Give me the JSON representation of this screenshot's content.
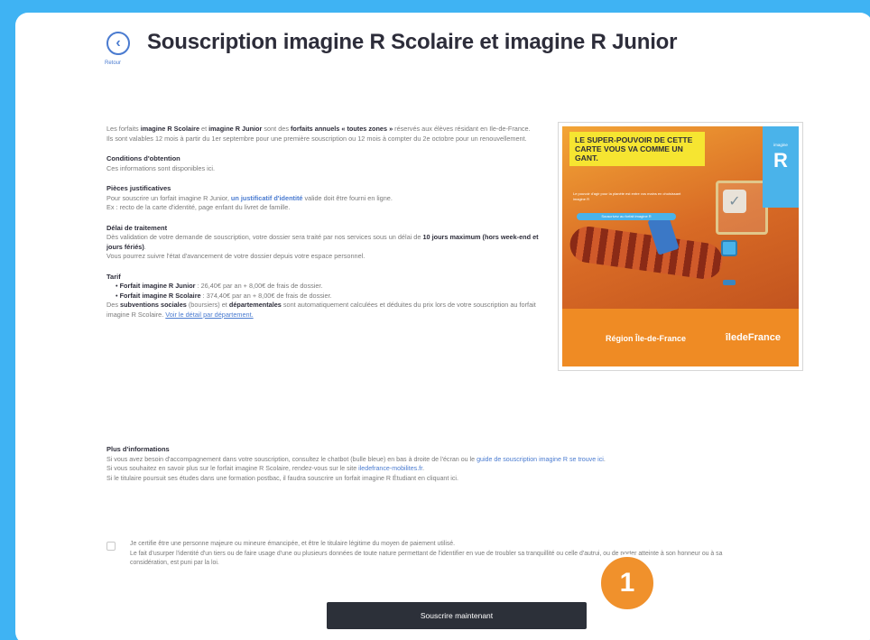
{
  "header": {
    "back_icon": "chevron-left-icon",
    "back_label": "Retour",
    "title": "Souscription imagine R Scolaire et imagine R Junior"
  },
  "intro": {
    "t1": "Les forfaits ",
    "b1": "imagine R Scolaire",
    "t2": " et ",
    "b2": "imagine R Junior",
    "t3": " sont des ",
    "b3": "forfaits annuels « toutes zones »",
    "t4": " réservés aux élèves résidant en Ile-de-France.",
    "line2": "Ils sont valables 12 mois à partir du 1er septembre pour une première souscription ou 12 mois à compter du 2e octobre pour un renouvellement."
  },
  "conditions": {
    "title": "Conditions d'obtention",
    "text": "Ces informations sont disponibles ici."
  },
  "pieces": {
    "title": "Pièces justificatives",
    "t1": "Pour souscrire un forfait imagine R Junior, ",
    "link": "un justificatif d'identité",
    "t2": " valide doit être fourni en ligne.",
    "line2": "Ex : recto de la carte d'identité, page enfant du livret de famille."
  },
  "delai": {
    "title": "Délai de traitement",
    "t1": "Dès validation de votre demande de souscription, votre dossier sera traité par nos services sous un délai de ",
    "b1": "10 jours maximum (hors week-end et jours fériés)",
    "t2": ".",
    "line2": "Vous pourrez suivre l'état d'avancement de votre dossier depuis votre espace personnel."
  },
  "tarif": {
    "title": "Tarif",
    "items": [
      {
        "label": "Forfait imagine R Junior",
        "text": " : 26,40€ par an + 8,00€ de frais de dossier."
      },
      {
        "label": "Forfait imagine R Scolaire",
        "text": " : 374,40€ par an + 8,00€ de frais de dossier."
      }
    ],
    "t1": "Des ",
    "b1": "subventions sociales",
    "t2": " (boursiers) et ",
    "b2": "départementales",
    "t3": " sont automatiquement calculées et déduites du prix lors de votre souscription au forfait imagine R Scolaire. ",
    "link": "Voir le détail par département."
  },
  "promo": {
    "headline": "LE SUPER-POUVOIR DE CETTE CARTE VOUS VA COMME UN GANT.",
    "sub": "Le pouvoir d'agir pour la planète est entre vos mains en choisissant imagine R",
    "cta": "Souscrivez au forfait imagine R",
    "logo_small": "imagine",
    "logo_big": "R",
    "brand1": "Région Île-de-France",
    "brand2": "îledeFrance"
  },
  "more": {
    "title": "Plus d'informations",
    "t1": "Si vous avez besoin d'accompagnement dans votre souscription, consultez le chatbot (bulle bleue) en bas à droite de l'écran ou le ",
    "link1": "guide de souscription imagine R se trouve ici",
    "t2": ".",
    "t3": "Si vous souhaitez en savoir plus sur le forfait imagine R Scolaire, rendez-vous sur le site ",
    "link2": "iledefrance-mobilites.fr",
    "t4": ".",
    "line3": "Si le titulaire poursuit ses études dans une formation postbac, il faudra souscrire un forfait imagine R Étudiant en cliquant ici."
  },
  "consent": {
    "line1": "Je certifie être une personne majeure ou mineure émancipée, et être le titulaire légitime du moyen de paiement utilisé.",
    "line2": "Le fait d'usurper l'identité d'un tiers ou de faire usage d'une ou plusieurs données de toute nature permettant de l'identifier en vue de troubler sa tranquillité ou celle d'autrui, ou de porter atteinte à son honneur ou à sa considération, est puni par la loi."
  },
  "submit_label": "Souscrire maintenant",
  "step_badge": "1",
  "colors": {
    "background": "#3fb3f3",
    "accent": "#4a7bd0",
    "button": "#2c3039",
    "badge": "#f0912c"
  }
}
